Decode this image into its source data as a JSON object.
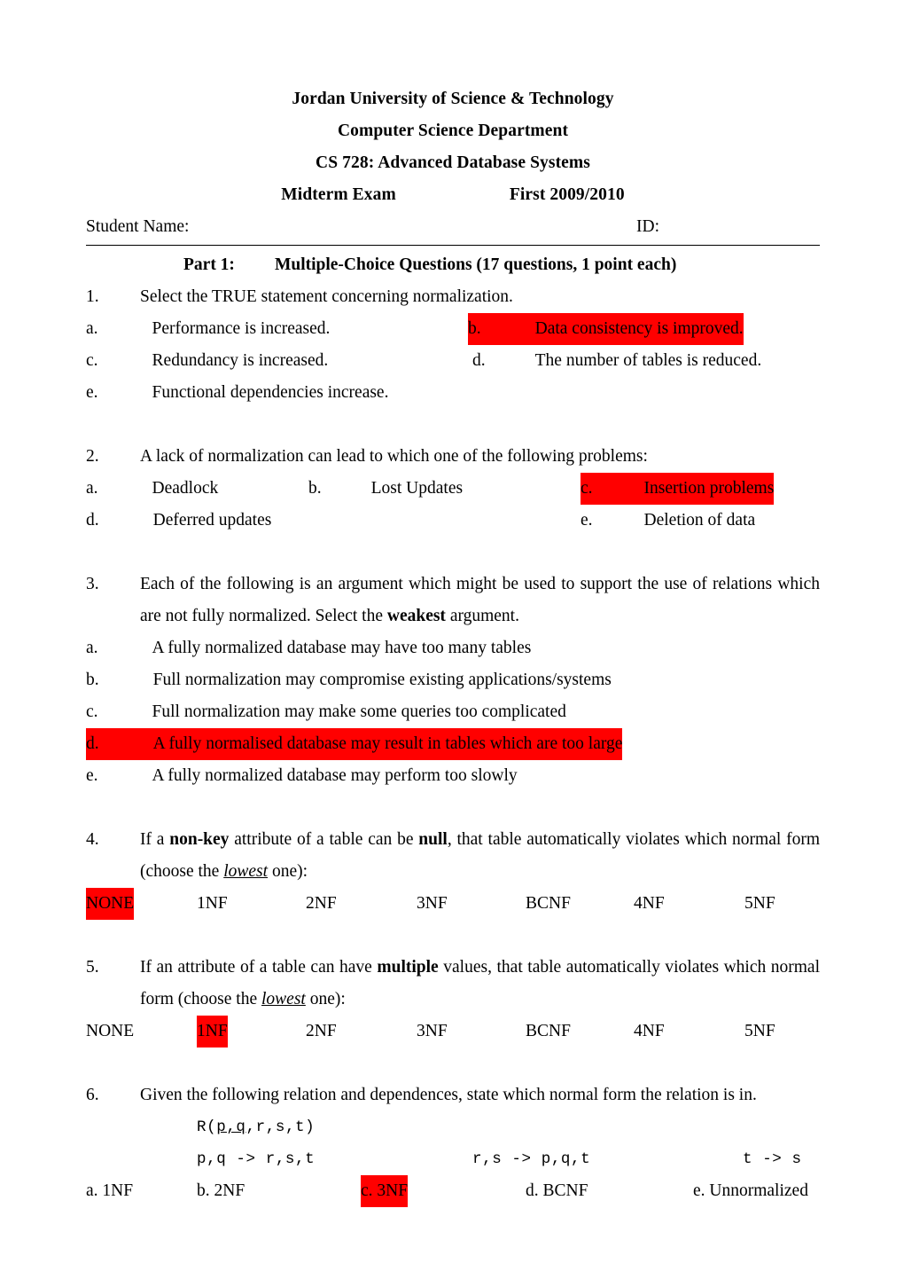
{
  "document": {
    "header": {
      "university": "Jordan University of Science & Technology",
      "department": "Computer Science Department",
      "course": "CS 728: Advanced Database Systems",
      "exam_label": "Midterm Exam",
      "term": "First 2009/2010",
      "student_name_label": "Student Name:",
      "id_label": "ID:"
    },
    "part": {
      "label": "Part 1:",
      "title": "Multiple-Choice Questions  (17 questions, 1 point each)"
    },
    "questions": [
      {
        "number": "1.",
        "text": "Select the TRUE statement concerning normalization.",
        "options": {
          "a_label": "a.",
          "a_text": "Performance is increased.",
          "b_label": "b.",
          "b_text": "Data consistency is improved.",
          "c_label": "c.",
          "c_text": "Redundancy is increased.",
          "d_label": "d.",
          "d_text": "The number of tables is reduced.",
          "e_label": "e.",
          "e_text": "Functional dependencies increase."
        },
        "highlighted": "b"
      },
      {
        "number": "2.",
        "text": "A lack of normalization can lead to which one of the following problems:",
        "options": {
          "a_label": "a.",
          "a_text": "Deadlock",
          "b_label": "b.",
          "b_text": "Lost Updates",
          "c_label": "c.",
          "c_text": "Insertion problems",
          "d_label": "d.",
          "d_text": "Deferred updates",
          "e_label": "e.",
          "e_text": "Deletion of data"
        },
        "highlighted": "c"
      },
      {
        "number": "3.",
        "text_part1": "Each of the following is an argument which might be used to support the use of relations which are not fully normalized. Select the ",
        "text_bold": "weakest",
        "text_part2": " argument.",
        "options": {
          "a_label": "a.",
          "a_text": "A fully normalized database may have too many tables",
          "b_label": "b.",
          "b_text": "Full normalization may compromise existing applications/systems",
          "c_label": "c.",
          "c_text": "Full normalization may make some queries too complicated",
          "d_label": "d.",
          "d_text": "A fully normalised database may result in tables which are too large",
          "e_label": "e.",
          "e_text": "A fully normalized database may perform too slowly"
        },
        "highlighted": "d"
      },
      {
        "number": "4.",
        "t1": "If a ",
        "b1": "non-key",
        "t2": " attribute of a table can be ",
        "b2": "null",
        "t3": ", that table automatically violates which normal form (choose the ",
        "i1": "lowest",
        "t4": " one):",
        "nf_options": [
          "NONE",
          "1NF",
          "2NF",
          "3NF",
          "BCNF",
          "4NF",
          "5NF"
        ],
        "highlighted_index": 0
      },
      {
        "number": "5.",
        "t1": "If an attribute of a table can have ",
        "b1": "multiple",
        "t2": " values, that table automatically violates which normal form (choose the ",
        "i1": "lowest",
        "t3": " one):",
        "nf_options": [
          "NONE",
          "1NF",
          "2NF",
          "3NF",
          "BCNF",
          "4NF",
          "5NF"
        ],
        "highlighted_index": 1
      },
      {
        "number": "6.",
        "text": "Given the following relation and dependences, state which normal form the relation is in.",
        "relation_prefix": "R(",
        "relation_key": "p,q",
        "relation_rest": ",r,s,t)",
        "fd1": "p,q -> r,s,t",
        "fd2": "r,s -> p,q,t",
        "fd3": "t -> s",
        "options": {
          "a": "a. 1NF",
          "b": "b. 2NF",
          "c": "c. 3NF",
          "d": "d. BCNF",
          "e": "e. Unnormalized"
        },
        "highlighted": "c"
      }
    ],
    "colors": {
      "highlight": "#FF0000",
      "text": "#000000",
      "background": "#FFFFFF"
    }
  }
}
